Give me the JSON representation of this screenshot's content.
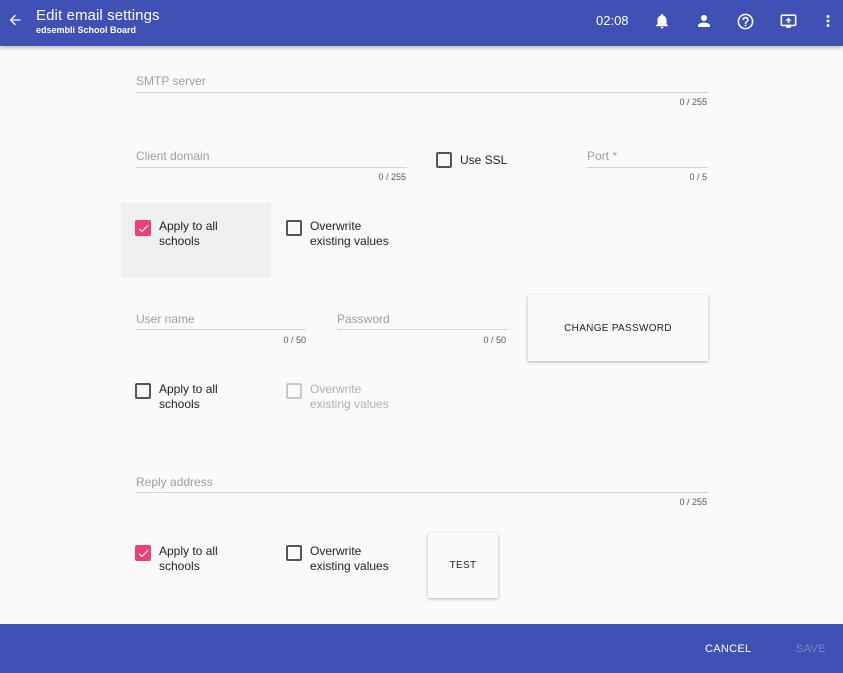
{
  "header": {
    "title": "Edit email settings",
    "subtitle": "edsembli School Board",
    "time": "02:08",
    "icons": [
      "arrow-left-icon",
      "bell-icon",
      "person-icon",
      "help-circle-icon",
      "monitor-icon",
      "more-vert-icon"
    ],
    "color": "#3f51b5"
  },
  "smtp": {
    "placeholder": "SMTP server",
    "value": "",
    "counter": "0 / 255"
  },
  "client_domain": {
    "placeholder": "Client domain",
    "value": "",
    "counter": "0 / 255"
  },
  "use_ssl": {
    "label": "Use SSL",
    "checked": false
  },
  "port": {
    "placeholder": "Port *",
    "value": "",
    "counter": "0 / 5"
  },
  "group1": {
    "apply_line1": "Apply to all",
    "apply_line2": "schools",
    "apply_checked": true,
    "overwrite_line1": "Overwrite",
    "overwrite_line2": "existing values",
    "overwrite_checked": false
  },
  "username": {
    "placeholder": "User name",
    "value": "",
    "counter": "0 / 50"
  },
  "password": {
    "placeholder": "Password",
    "value": "",
    "counter": "0 / 50"
  },
  "change_password_label": "CHANGE PASSWORD",
  "group2": {
    "apply_line1": "Apply to all",
    "apply_line2": "schools",
    "apply_checked": false,
    "overwrite_line1": "Overwrite",
    "overwrite_line2": "existing values",
    "overwrite_checked": false,
    "overwrite_disabled": true
  },
  "reply": {
    "placeholder": "Reply address",
    "value": "",
    "counter": "0 / 255"
  },
  "group3": {
    "apply_line1": "Apply to all",
    "apply_line2": "schools",
    "apply_checked": true,
    "overwrite_line1": "Overwrite",
    "overwrite_line2": "existing values",
    "overwrite_checked": false
  },
  "test_label": "TEST",
  "footer": {
    "cancel_label": "CANCEL",
    "save_label": "SAVE"
  },
  "colors": {
    "accent": "#ec407a",
    "primary": "#3f51b5",
    "disabled_text": "#7986cb"
  }
}
